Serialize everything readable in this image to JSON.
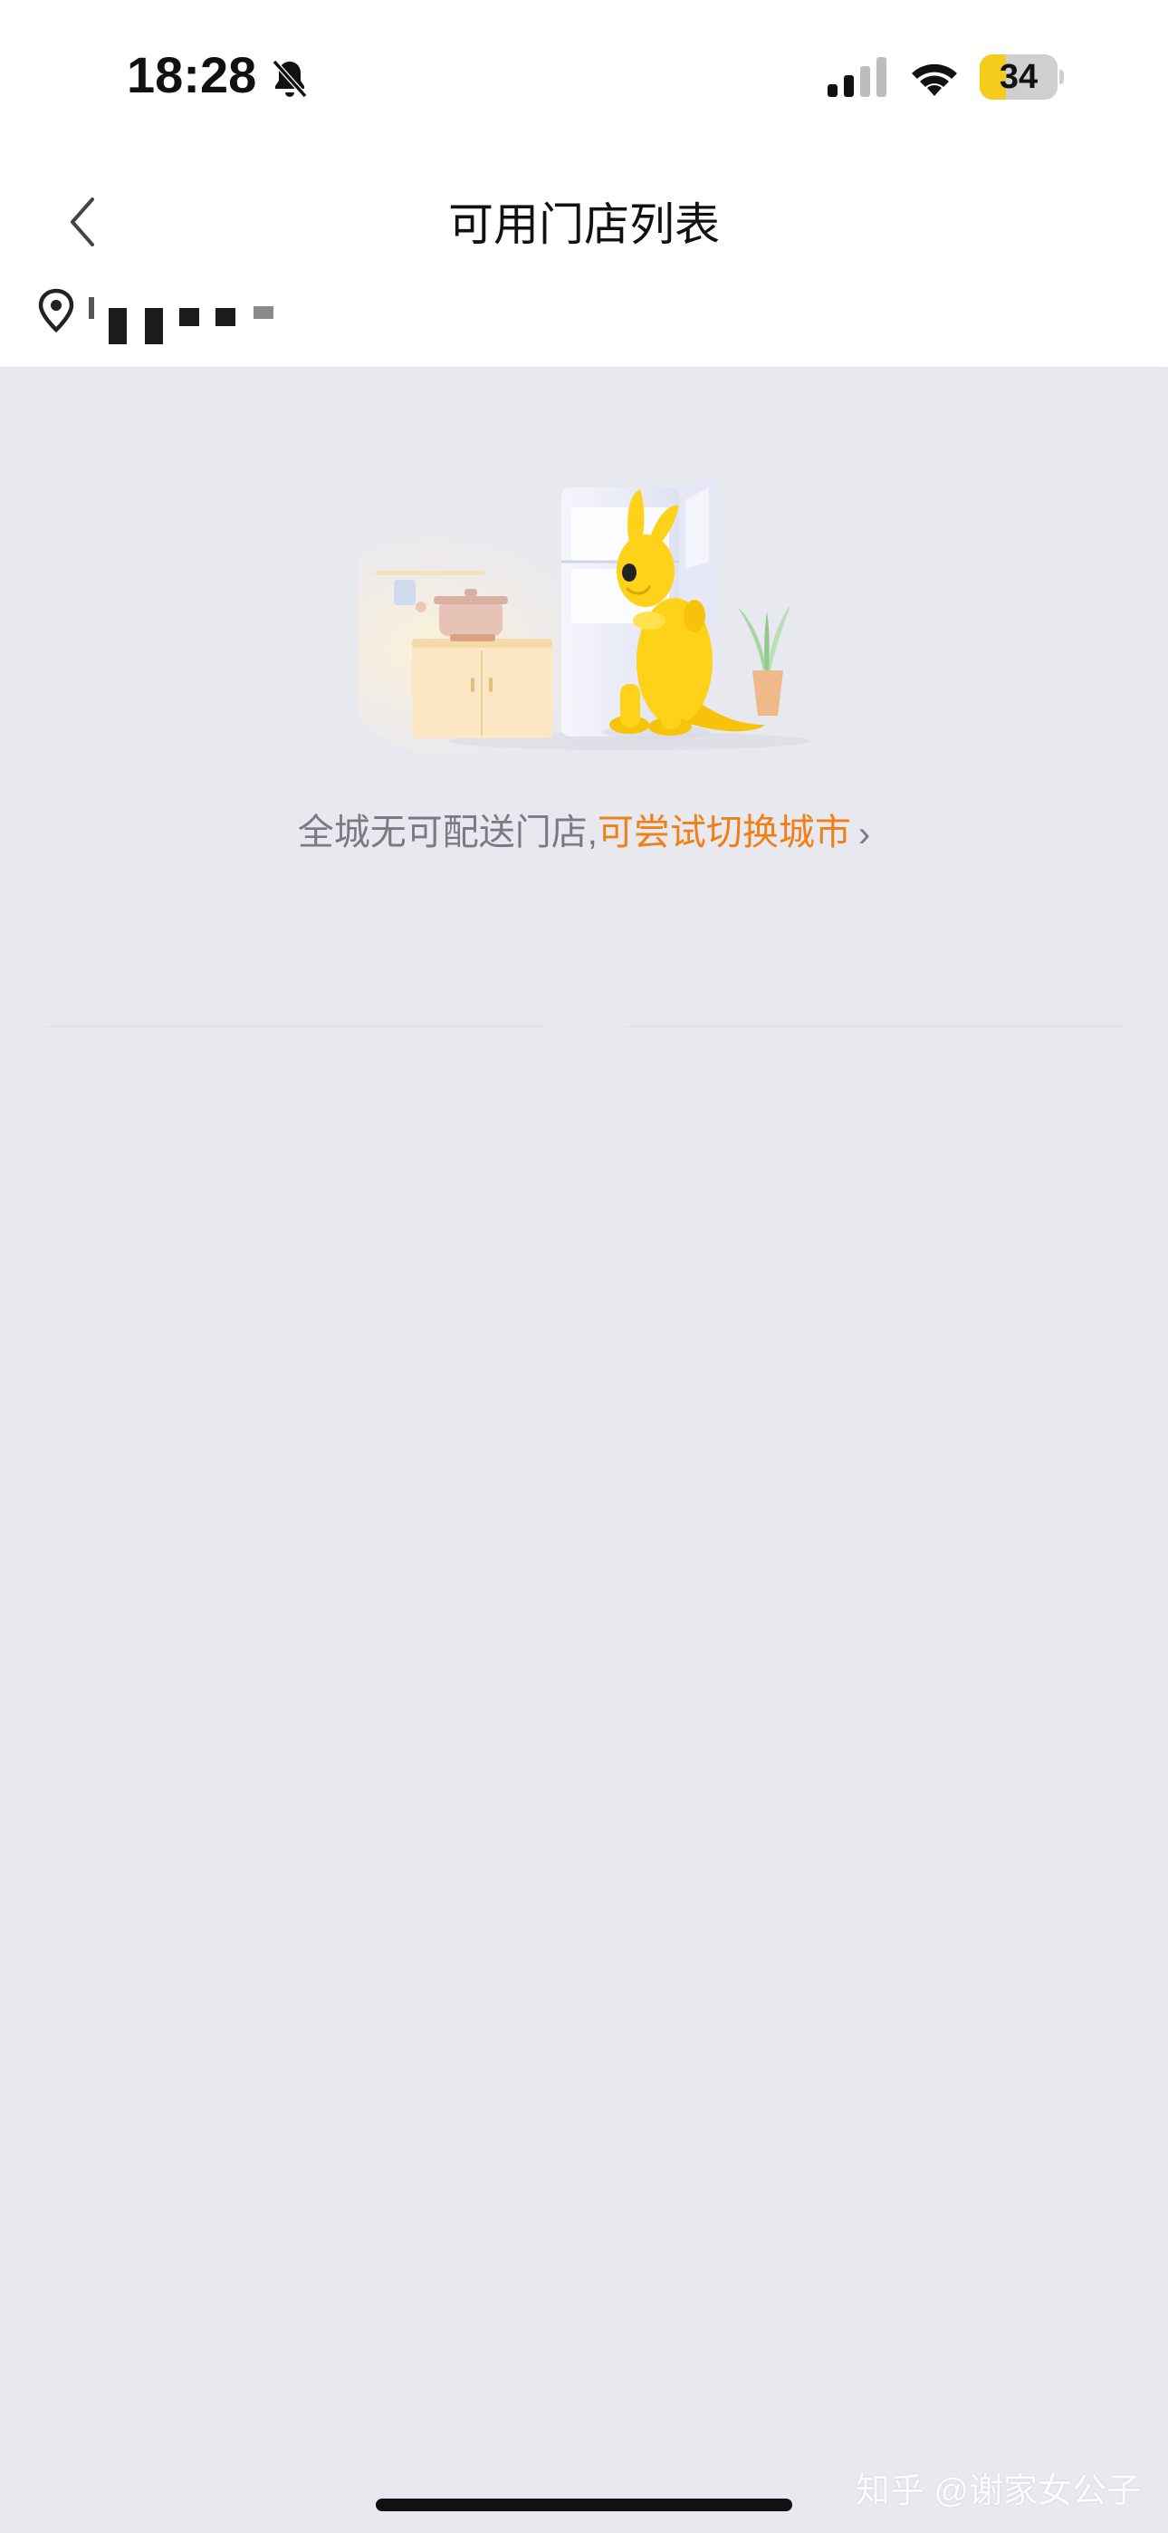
{
  "status_bar": {
    "time": "18:28",
    "battery_level": "34",
    "battery_fraction": 0.34,
    "mute_icon": "bell-slash-icon",
    "signal_icon": "cellular-signal-icon",
    "wifi_icon": "wifi-icon"
  },
  "nav": {
    "title": "可用门店列表",
    "back_icon": "chevron-left-icon"
  },
  "location": {
    "icon": "location-pin-icon"
  },
  "empty_state": {
    "message": "全城无可配送门店,",
    "action_label": "可尝试切换城市",
    "action_chevron": "›",
    "illustration": "kangaroo-mascot-fridge-illustration"
  },
  "watermark": {
    "text": "知乎 @谢家女公子"
  },
  "colors": {
    "accent": "#f07f17",
    "page_bg": "#e8e8ef",
    "header_bg": "#ffffff",
    "muted_text": "#7a7a85",
    "battery_yellow": "#f5cc1b"
  }
}
